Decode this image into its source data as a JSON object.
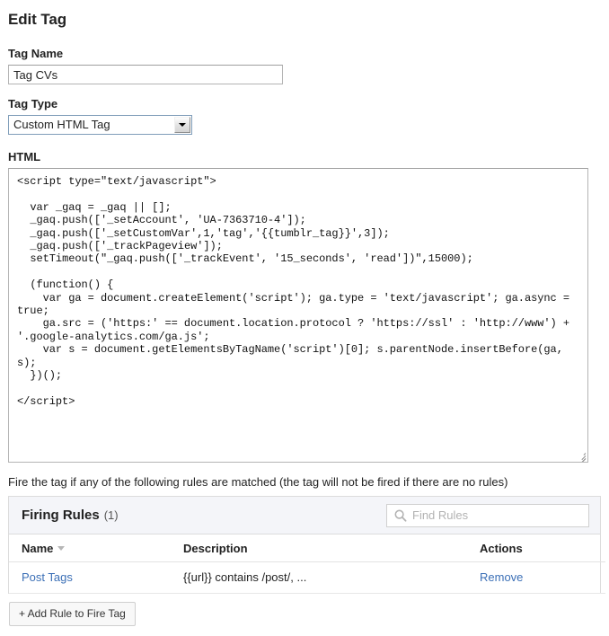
{
  "page": {
    "title": "Edit Tag"
  },
  "tag_name": {
    "label": "Tag Name",
    "value": "Tag CVs",
    "placeholder": ""
  },
  "tag_type": {
    "label": "Tag Type",
    "selected": "Custom HTML Tag",
    "options": [
      "Custom HTML Tag"
    ]
  },
  "html_field": {
    "label": "HTML",
    "value": "<script type=\"text/javascript\">\n\n  var _gaq = _gaq || [];\n  _gaq.push(['_setAccount', 'UA-7363710-4']);\n  _gaq.push(['_setCustomVar',1,'tag','{{tumblr_tag}}',3]);\n  _gaq.push(['_trackPageview']);\n  setTimeout(\"_gaq.push(['_trackEvent', '15_seconds', 'read'])\",15000);\n\n  (function() {\n    var ga = document.createElement('script'); ga.type = 'text/javascript'; ga.async = true;\n    ga.src = ('https:' == document.location.protocol ? 'https://ssl' : 'http://www') + '.google-analytics.com/ga.js';\n    var s = document.getElementsByTagName('script')[0]; s.parentNode.insertBefore(ga, s);\n  })();\n\n</scr"
  },
  "rules": {
    "caption": "Fire the tag if any of the following rules are matched (the tag will not be fired if there are no rules)",
    "panel_title": "Firing Rules",
    "panel_count": "(1)",
    "search_placeholder": "Find Rules",
    "search_value": "",
    "columns": {
      "name": "Name",
      "description": "Description",
      "actions": "Actions"
    },
    "rows": [
      {
        "name": "Post Tags",
        "description": "{{url}} contains /post/, ...",
        "action": "Remove"
      }
    ],
    "add_button": "+ Add Rule to Fire Tag"
  },
  "colors": {
    "link": "#3b6fb6",
    "panel_header_bg": "#f4f5f9",
    "border": "#dcdcdc"
  }
}
